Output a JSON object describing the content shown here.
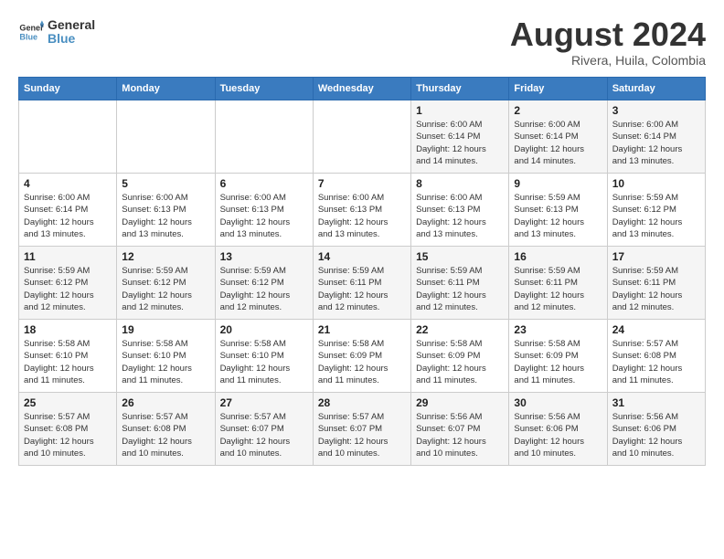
{
  "logo": {
    "line1": "General",
    "line2": "Blue"
  },
  "title": "August 2024",
  "location": "Rivera, Huila, Colombia",
  "days_of_week": [
    "Sunday",
    "Monday",
    "Tuesday",
    "Wednesday",
    "Thursday",
    "Friday",
    "Saturday"
  ],
  "weeks": [
    [
      {
        "day": "",
        "info": ""
      },
      {
        "day": "",
        "info": ""
      },
      {
        "day": "",
        "info": ""
      },
      {
        "day": "",
        "info": ""
      },
      {
        "day": "1",
        "info": "Sunrise: 6:00 AM\nSunset: 6:14 PM\nDaylight: 12 hours\nand 14 minutes."
      },
      {
        "day": "2",
        "info": "Sunrise: 6:00 AM\nSunset: 6:14 PM\nDaylight: 12 hours\nand 14 minutes."
      },
      {
        "day": "3",
        "info": "Sunrise: 6:00 AM\nSunset: 6:14 PM\nDaylight: 12 hours\nand 13 minutes."
      }
    ],
    [
      {
        "day": "4",
        "info": "Sunrise: 6:00 AM\nSunset: 6:14 PM\nDaylight: 12 hours\nand 13 minutes."
      },
      {
        "day": "5",
        "info": "Sunrise: 6:00 AM\nSunset: 6:13 PM\nDaylight: 12 hours\nand 13 minutes."
      },
      {
        "day": "6",
        "info": "Sunrise: 6:00 AM\nSunset: 6:13 PM\nDaylight: 12 hours\nand 13 minutes."
      },
      {
        "day": "7",
        "info": "Sunrise: 6:00 AM\nSunset: 6:13 PM\nDaylight: 12 hours\nand 13 minutes."
      },
      {
        "day": "8",
        "info": "Sunrise: 6:00 AM\nSunset: 6:13 PM\nDaylight: 12 hours\nand 13 minutes."
      },
      {
        "day": "9",
        "info": "Sunrise: 5:59 AM\nSunset: 6:13 PM\nDaylight: 12 hours\nand 13 minutes."
      },
      {
        "day": "10",
        "info": "Sunrise: 5:59 AM\nSunset: 6:12 PM\nDaylight: 12 hours\nand 13 minutes."
      }
    ],
    [
      {
        "day": "11",
        "info": "Sunrise: 5:59 AM\nSunset: 6:12 PM\nDaylight: 12 hours\nand 12 minutes."
      },
      {
        "day": "12",
        "info": "Sunrise: 5:59 AM\nSunset: 6:12 PM\nDaylight: 12 hours\nand 12 minutes."
      },
      {
        "day": "13",
        "info": "Sunrise: 5:59 AM\nSunset: 6:12 PM\nDaylight: 12 hours\nand 12 minutes."
      },
      {
        "day": "14",
        "info": "Sunrise: 5:59 AM\nSunset: 6:11 PM\nDaylight: 12 hours\nand 12 minutes."
      },
      {
        "day": "15",
        "info": "Sunrise: 5:59 AM\nSunset: 6:11 PM\nDaylight: 12 hours\nand 12 minutes."
      },
      {
        "day": "16",
        "info": "Sunrise: 5:59 AM\nSunset: 6:11 PM\nDaylight: 12 hours\nand 12 minutes."
      },
      {
        "day": "17",
        "info": "Sunrise: 5:59 AM\nSunset: 6:11 PM\nDaylight: 12 hours\nand 12 minutes."
      }
    ],
    [
      {
        "day": "18",
        "info": "Sunrise: 5:58 AM\nSunset: 6:10 PM\nDaylight: 12 hours\nand 11 minutes."
      },
      {
        "day": "19",
        "info": "Sunrise: 5:58 AM\nSunset: 6:10 PM\nDaylight: 12 hours\nand 11 minutes."
      },
      {
        "day": "20",
        "info": "Sunrise: 5:58 AM\nSunset: 6:10 PM\nDaylight: 12 hours\nand 11 minutes."
      },
      {
        "day": "21",
        "info": "Sunrise: 5:58 AM\nSunset: 6:09 PM\nDaylight: 12 hours\nand 11 minutes."
      },
      {
        "day": "22",
        "info": "Sunrise: 5:58 AM\nSunset: 6:09 PM\nDaylight: 12 hours\nand 11 minutes."
      },
      {
        "day": "23",
        "info": "Sunrise: 5:58 AM\nSunset: 6:09 PM\nDaylight: 12 hours\nand 11 minutes."
      },
      {
        "day": "24",
        "info": "Sunrise: 5:57 AM\nSunset: 6:08 PM\nDaylight: 12 hours\nand 11 minutes."
      }
    ],
    [
      {
        "day": "25",
        "info": "Sunrise: 5:57 AM\nSunset: 6:08 PM\nDaylight: 12 hours\nand 10 minutes."
      },
      {
        "day": "26",
        "info": "Sunrise: 5:57 AM\nSunset: 6:08 PM\nDaylight: 12 hours\nand 10 minutes."
      },
      {
        "day": "27",
        "info": "Sunrise: 5:57 AM\nSunset: 6:07 PM\nDaylight: 12 hours\nand 10 minutes."
      },
      {
        "day": "28",
        "info": "Sunrise: 5:57 AM\nSunset: 6:07 PM\nDaylight: 12 hours\nand 10 minutes."
      },
      {
        "day": "29",
        "info": "Sunrise: 5:56 AM\nSunset: 6:07 PM\nDaylight: 12 hours\nand 10 minutes."
      },
      {
        "day": "30",
        "info": "Sunrise: 5:56 AM\nSunset: 6:06 PM\nDaylight: 12 hours\nand 10 minutes."
      },
      {
        "day": "31",
        "info": "Sunrise: 5:56 AM\nSunset: 6:06 PM\nDaylight: 12 hours\nand 10 minutes."
      }
    ]
  ]
}
